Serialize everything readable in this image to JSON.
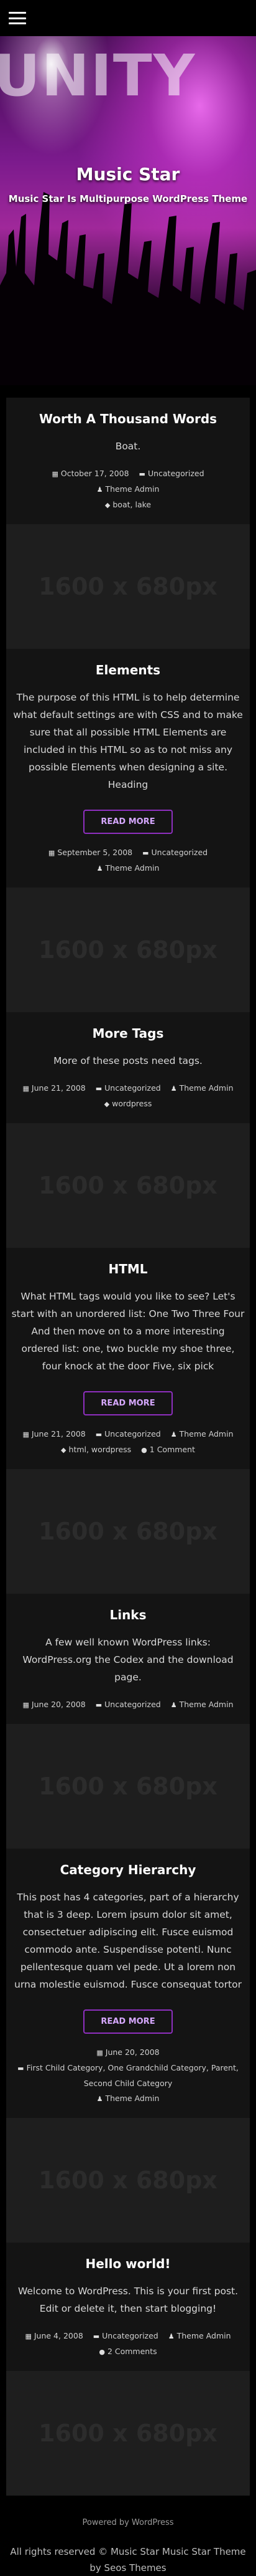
{
  "header": {
    "menu_icon": "hamburger-icon"
  },
  "hero": {
    "big_text": "UNITY",
    "title": "Music Star",
    "description": "Music Star Is Multipurpose WordPress Theme"
  },
  "posts": [
    {
      "title": "Worth A Thousand Words",
      "excerpt": "Boat.",
      "date": "October 17, 2008",
      "category": "Uncategorized",
      "author": "Theme Admin",
      "tags": "boat, lake",
      "thumb": "1600 x 680px"
    },
    {
      "title": "Elements",
      "excerpt": "The purpose of this HTML is to help determine what default settings are with CSS and to make sure that all possible HTML Elements are included in this HTML so as to not miss any possible Elements when designing a site. Heading",
      "read_more": "READ MORE",
      "date": "September 5, 2008",
      "category": "Uncategorized",
      "author": "Theme Admin",
      "thumb": "1600 x 680px"
    },
    {
      "title": "More Tags",
      "excerpt": "More of these posts need tags.",
      "date": "June 21, 2008",
      "category": "Uncategorized",
      "author": "Theme Admin",
      "tags": "wordpress",
      "thumb": "1600 x 680px"
    },
    {
      "title": "HTML",
      "excerpt": "What HTML tags would you like to see? Let's start with an unordered list: One Two Three Four And then move on to a more interesting ordered list: one, two buckle my shoe three, four knock at the door Five, six pick",
      "read_more": "READ MORE",
      "date": "June 21, 2008",
      "category": "Uncategorized",
      "author": "Theme Admin",
      "tags": "html, wordpress",
      "comments": "1 Comment",
      "thumb": "1600 x 680px"
    },
    {
      "title": "Links",
      "excerpt": "A few well known WordPress links: WordPress.org the Codex and the download page.",
      "date": "June 20, 2008",
      "category": "Uncategorized",
      "author": "Theme Admin",
      "thumb": "1600 x 680px"
    },
    {
      "title": "Category Hierarchy",
      "excerpt": "This post has 4 categories, part of a hierarchy that is 3 deep. Lorem ipsum dolor sit amet, consectetuer adipiscing elit. Fusce euismod commodo ante. Suspendisse potenti. Nunc pellentesque quam vel pede. Ut a lorem non urna molestie euismod. Fusce consequat tortor",
      "read_more": "READ MORE",
      "date": "June 20, 2008",
      "category": "First Child Category, One Grandchild Category, Parent, Second Child Category",
      "author": "Theme Admin",
      "thumb": "1600 x 680px"
    },
    {
      "title": "Hello world!",
      "excerpt": "Welcome to WordPress. This is your first post. Edit or delete it, then start blogging!",
      "date": "June 4, 2008",
      "category": "Uncategorized",
      "author": "Theme Admin",
      "comments": "2 Comments",
      "thumb": "1600 x 680px"
    }
  ],
  "footer": {
    "powered": "Powered by WordPress",
    "copyright": "All rights reserved © Music Star Music Star Theme by Seos Themes"
  },
  "colors": {
    "accent": "#8e2fbf",
    "card_bg": "#141414",
    "page_bg": "#000000"
  }
}
